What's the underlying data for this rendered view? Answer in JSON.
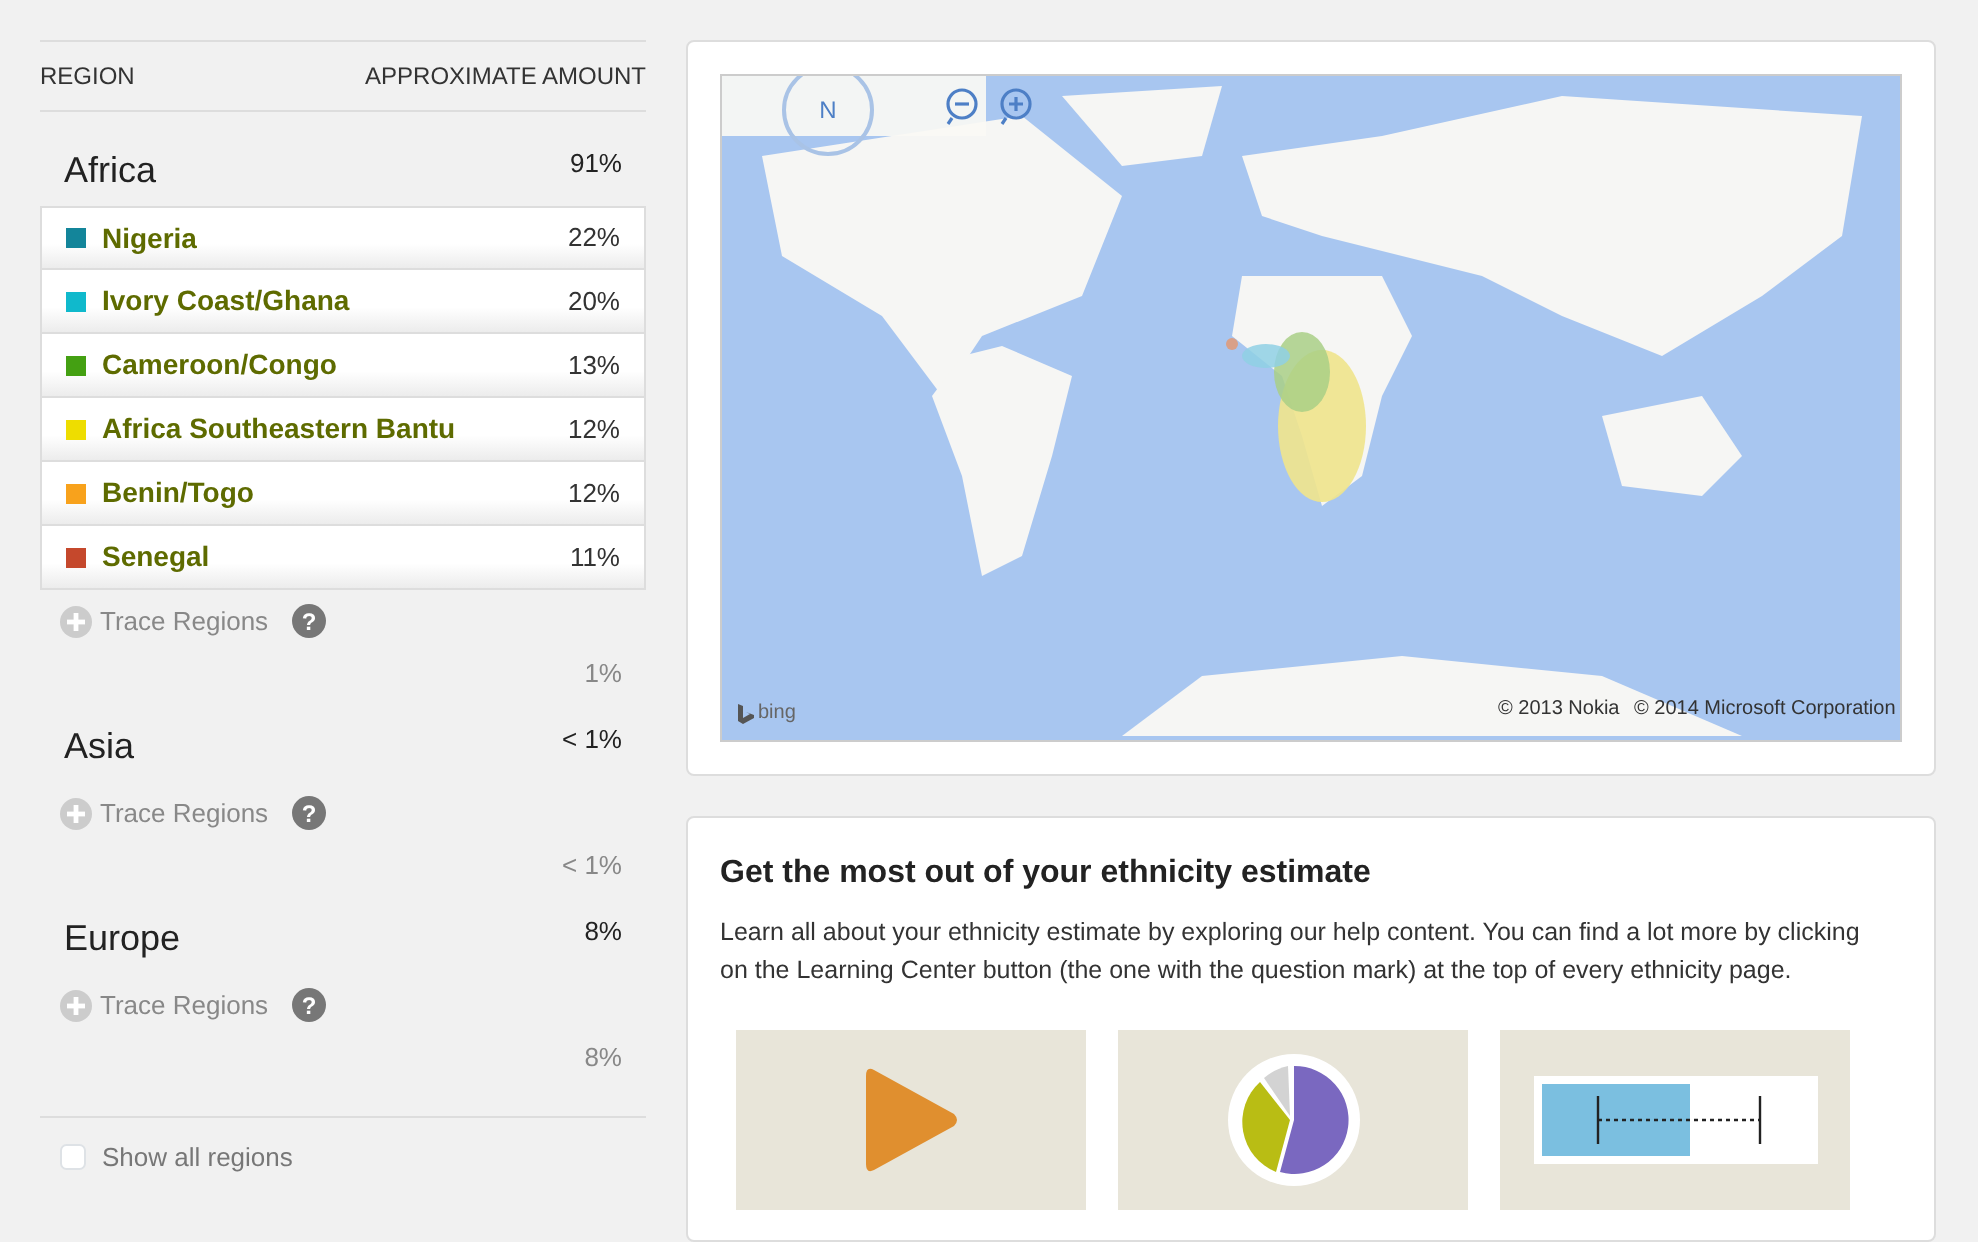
{
  "table": {
    "columns": [
      "REGION",
      "APPROXIMATE AMOUNT"
    ]
  },
  "groups": [
    {
      "name": "Africa",
      "amount": "91%",
      "subregions": [
        {
          "name": "Nigeria",
          "amount": "22%",
          "color": "#13859a"
        },
        {
          "name": "Ivory Coast/Ghana",
          "amount": "20%",
          "color": "#10b9cc"
        },
        {
          "name": "Cameroon/Congo",
          "amount": "13%",
          "color": "#44a012"
        },
        {
          "name": "Africa Southeastern Bantu",
          "amount": "12%",
          "color": "#eedd00"
        },
        {
          "name": "Benin/Togo",
          "amount": "12%",
          "color": "#f8a21c"
        },
        {
          "name": "Senegal",
          "amount": "11%",
          "color": "#c5482c"
        }
      ],
      "trace_label": "Trace Regions",
      "help_mark": "?",
      "other_amount": "1%"
    },
    {
      "name": "Asia",
      "amount": "< 1%",
      "trace_label": "Trace Regions",
      "help_mark": "?",
      "other_amount": "< 1%"
    },
    {
      "name": "Europe",
      "amount": "8%",
      "trace_label": "Trace Regions",
      "help_mark": "?",
      "other_amount": "8%"
    }
  ],
  "show_all": {
    "label": "Show all regions",
    "checked": false
  },
  "map": {
    "compass": "N",
    "logo": "bing",
    "copyrights": [
      "© 2013 Nokia",
      "© 2014 Microsoft Corporation"
    ]
  },
  "help": {
    "title": "Get the most out of your ethnicity estimate",
    "text": "Learn all about your ethnicity estimate by exploring our help content. You can find a lot more by clicking on the Learning Center button (the one with the question mark) at the top of every ethnicity page.",
    "tiles": [
      {
        "kind": "video"
      },
      {
        "kind": "pie"
      },
      {
        "kind": "range"
      }
    ]
  }
}
